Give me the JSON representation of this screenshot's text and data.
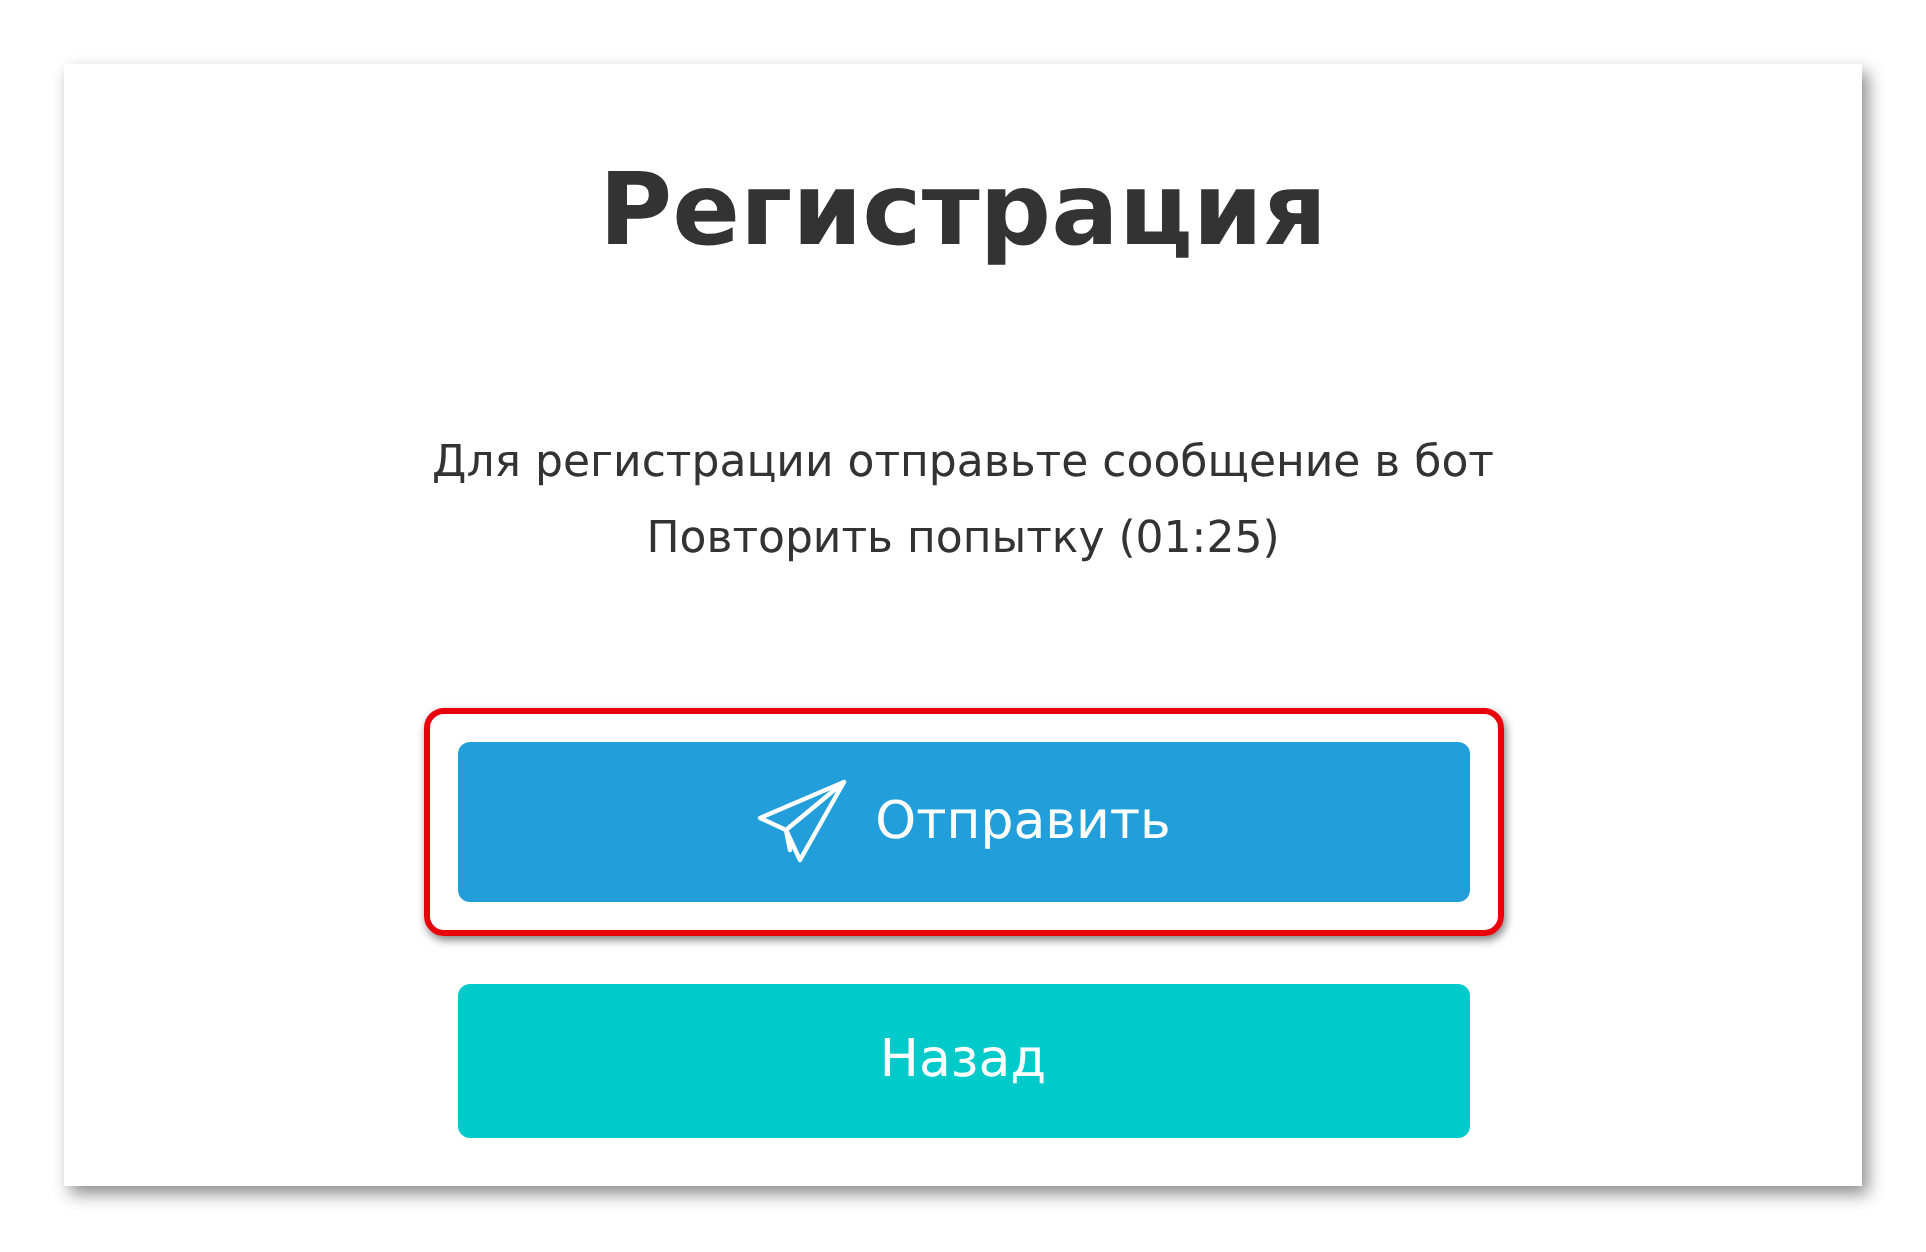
{
  "title": "Регистрация",
  "message": [
    "Для регистрации отправьте сообщение в бот",
    "Повторить попытку (01:25)"
  ],
  "buttons": [
    {
      "kind": "send",
      "label": "Отправить",
      "highlighted": true
    },
    {
      "kind": "back",
      "label": "Назад",
      "highlighted": false
    }
  ]
}
